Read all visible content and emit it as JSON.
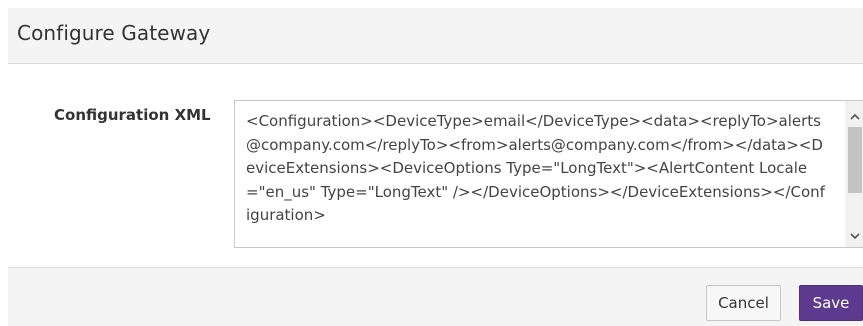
{
  "dialog": {
    "title": "Configure Gateway"
  },
  "form": {
    "label": "Configuration XML",
    "value": "<Configuration><DeviceType>email</DeviceType><data><replyTo>alerts@company.com</replyTo><from>alerts@company.com</from></data><DeviceExtensions><DeviceOptions Type=\"LongText\"><AlertContent Locale=\"en_us\" Type=\"LongText\" /></DeviceOptions></DeviceExtensions></Configuration>"
  },
  "footer": {
    "cancel_label": "Cancel",
    "save_label": "Save"
  },
  "colors": {
    "accent": "#5c3a8e",
    "header_bg": "#f4f4f5"
  },
  "icons": {
    "scroll_up": "chevron-up-icon",
    "scroll_down": "chevron-down-icon"
  }
}
